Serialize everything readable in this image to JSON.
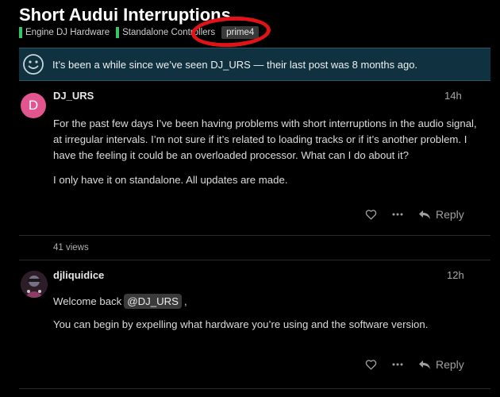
{
  "topic": {
    "title": "Short Audui Interruptions",
    "categories": [
      "Engine DJ Hardware",
      "Standalone Controllers"
    ],
    "tag": "prime4"
  },
  "notice": {
    "message": "It’s been a while since we’ve seen DJ_URS — their last post was 8 months ago."
  },
  "posts": [
    {
      "avatar_letter": "D",
      "username": "DJ_URS",
      "time": "14h",
      "paragraphs": [
        "For the past few days I’ve been having problems with short interruptions in the audio signal, at irregular intervals. I’m not sure if it’s related to loading tracks or if it’s another problem. I have the feeling it could be an overloaded processor. What can I do about it?",
        "I only have it on standalone. All updates are made."
      ],
      "reply_label": "Reply",
      "views": "41 views"
    },
    {
      "username": "djliquidice",
      "time": "12h",
      "greeting_prefix": "Welcome back",
      "mention": "@DJ_URS",
      "greeting_suffix": ",",
      "paragraph": "You can begin by expelling what hardware you’re using and the software version.",
      "reply_label": "Reply"
    }
  ],
  "colors": {
    "category_bar": "#35c46a",
    "notice_bg": "#0f3140",
    "avatar_d": "#e2558f",
    "annotation": "#e01418"
  },
  "icons": [
    "smile-icon",
    "heart-icon",
    "more-icon",
    "reply-icon"
  ]
}
